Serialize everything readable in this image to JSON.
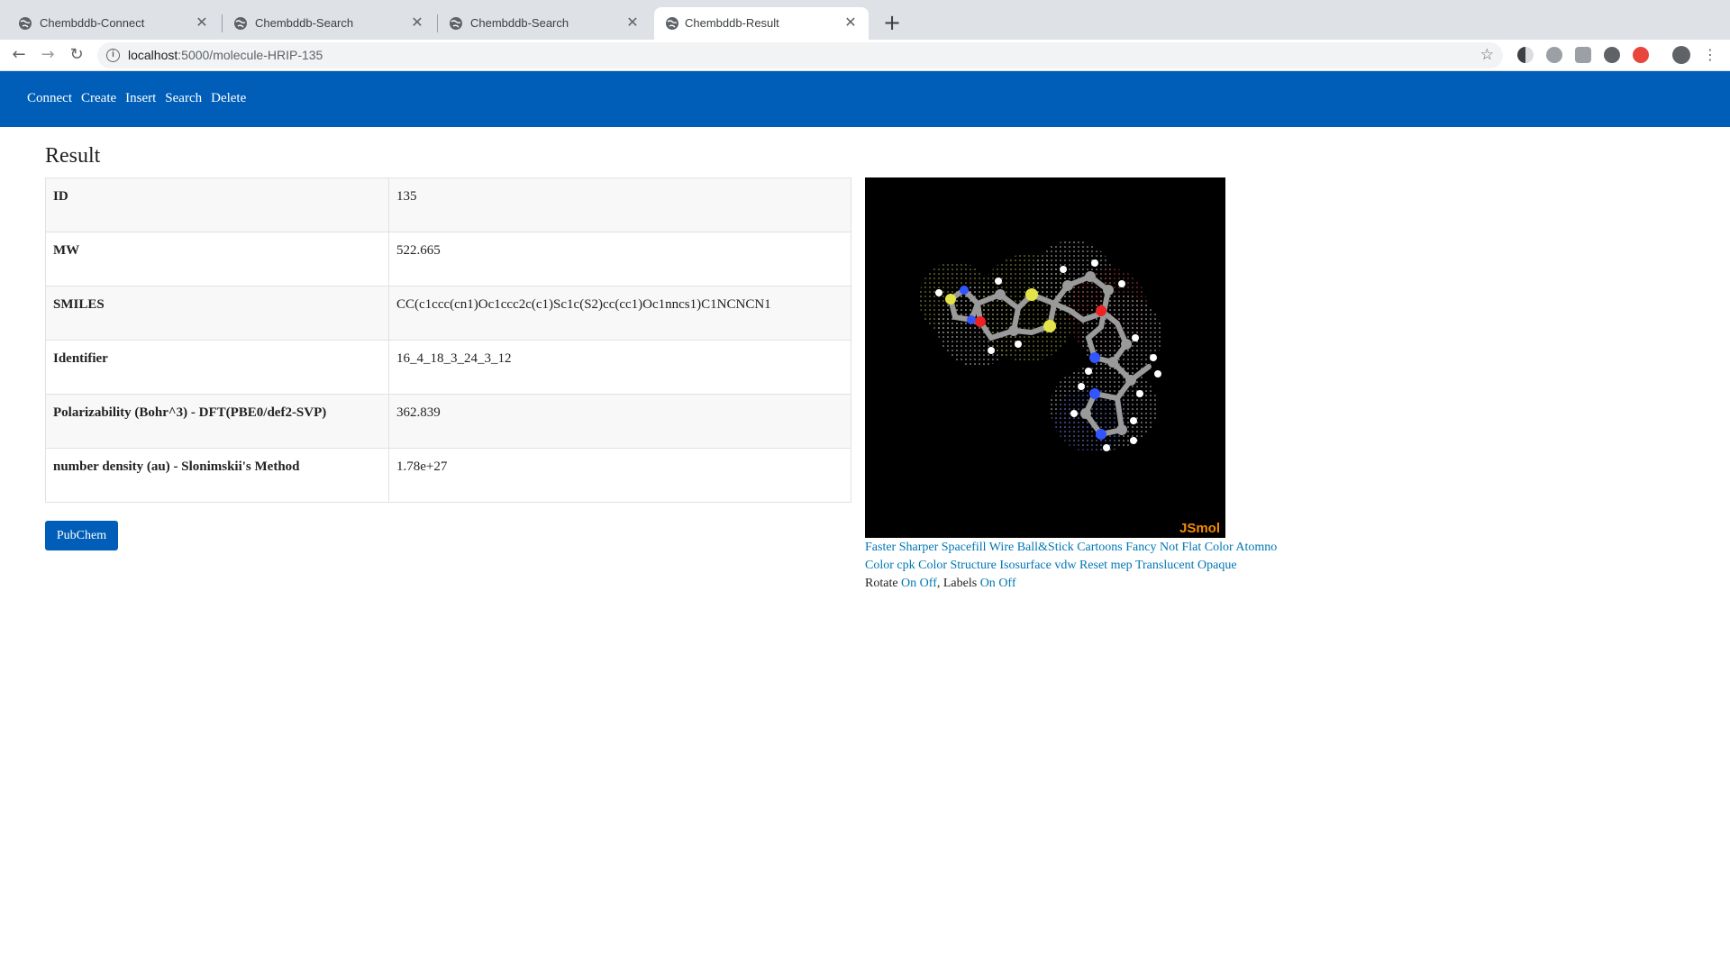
{
  "browser": {
    "tabs": [
      {
        "title": "Chembddb-Connect",
        "active": false
      },
      {
        "title": "Chembddb-Search",
        "active": false
      },
      {
        "title": "Chembddb-Search",
        "active": false
      },
      {
        "title": "Chembddb-Result",
        "active": true
      }
    ],
    "url_host": "localhost",
    "url_path": ":5000/molecule-HRIP-135"
  },
  "navbar": {
    "links": [
      "Connect",
      "Create",
      "Insert",
      "Search",
      "Delete"
    ]
  },
  "main": {
    "title": "Result",
    "table": [
      {
        "key": "ID",
        "value": "135"
      },
      {
        "key": "MW",
        "value": "522.665"
      },
      {
        "key": "SMILES",
        "value": "CC(c1ccc(cn1)Oc1ccc2c(c1)Sc1c(S2)cc(cc1)Oc1nncs1)C1NCNCN1"
      },
      {
        "key": "Identifier",
        "value": "16_4_18_3_24_3_12"
      },
      {
        "key": "Polarizability (Bohr^3) - DFT(PBE0/def2-SVP)",
        "value": "362.839"
      },
      {
        "key": "number density (au) - Slonimskii's Method",
        "value": "1.78e+27"
      }
    ],
    "pubchem_button": "PubChem"
  },
  "viewer": {
    "label": "JSmol",
    "controls_row1": [
      "Faster",
      "Sharper",
      "Spacefill",
      "Wire",
      "Ball&Stick",
      "Cartoons",
      "Fancy",
      "Not Flat",
      "Color Atomno"
    ],
    "controls_row2": [
      "Color cpk",
      "Color Structure",
      "Isosurface vdw",
      "Reset",
      "mep",
      "Translucent",
      "Opaque"
    ],
    "rotate_label": "Rotate",
    "rotate_on": "On",
    "rotate_off": "Off",
    "sep": ",",
    "labels_label": "Labels",
    "labels_on": "On",
    "labels_off": "Off"
  }
}
